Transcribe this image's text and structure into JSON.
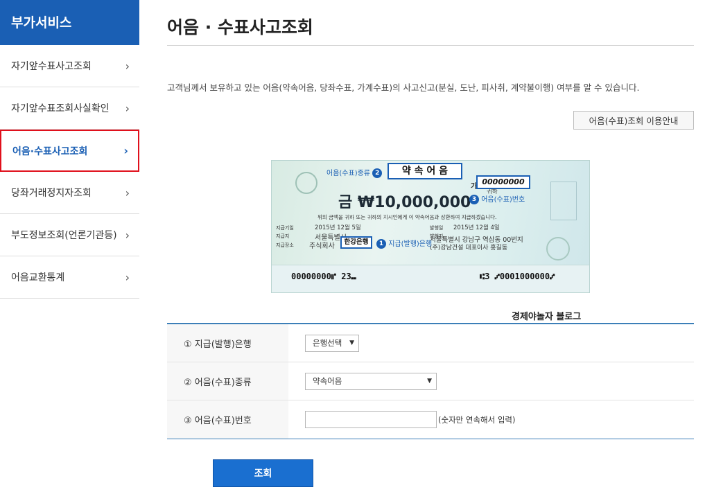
{
  "sidebar": {
    "title": "부가서비스",
    "items": [
      {
        "label": "자기앞수표사고조회",
        "active": false
      },
      {
        "label": "자기앞수표조회사실확인",
        "active": false
      },
      {
        "label": "어음·수표사고조회",
        "active": true
      },
      {
        "label": "당좌거래정지자조회",
        "active": false
      },
      {
        "label": "부도정보조회(언론기관등)",
        "active": false
      },
      {
        "label": "어음교환통계",
        "active": false
      }
    ],
    "chevron": "›"
  },
  "main": {
    "title": "어음 · 수표사고조회",
    "description": "고객님께서 보유하고 있는 어음(약속어음, 당좌수표, 가계수표)의 사고신고(분실, 도난, 피사취, 계약불이행) 여부를 알 수 있습니다.",
    "guide_button": "어음(수표)조회 이용안내"
  },
  "check_image": {
    "type_annotation": "어음(수표)종류",
    "type_badge": "2",
    "type_value": "약 속 어 음",
    "to_label": "귀하",
    "number_prefix": "가가",
    "number_value": "00000000",
    "number_badge": "3",
    "number_annotation": "어음(수표)번호",
    "amount": "금 ₩10,000,000",
    "notice_text": "위의 금액을 귀하 또는 귀하의 지시인에게 이 약속어음과 상환하여 지급하겠습니다.",
    "pay_date_label": "지급기일",
    "pay_date": "2015년 12월 5일",
    "pay_place_label": "지급지",
    "pay_place": "서울특별시",
    "pay_bank_label": "지급장소",
    "pay_company": "주식회사",
    "bank_highlight": "한강은행",
    "bank_badge": "1",
    "bank_annotation": "지급(발행)은행",
    "issue_date_label": "발행일",
    "issue_date": "2015년 12월 4일",
    "issue_place_label": "발행지",
    "issuer_address": "서울특별시 강남구 역삼동 00번지",
    "issuer_name": "(주)강남건설 대표이사 홍길동",
    "micr_left": "00000000⑈ 23⑉",
    "micr_right": "⑆3 ⑇0001000000⑇"
  },
  "caption": "경제야놀자 블로그",
  "form": {
    "rows": [
      {
        "label": "① 지급(발행)은행",
        "control": "select",
        "value": "은행선택"
      },
      {
        "label": "② 어음(수표)종류",
        "control": "select",
        "value": "약속어음"
      },
      {
        "label": "③ 어음(수표)번호",
        "control": "text",
        "value": "",
        "hint": "(숫자만 연속해서 입력)"
      }
    ],
    "arrow_glyph": "▼"
  },
  "search_button": "조회"
}
